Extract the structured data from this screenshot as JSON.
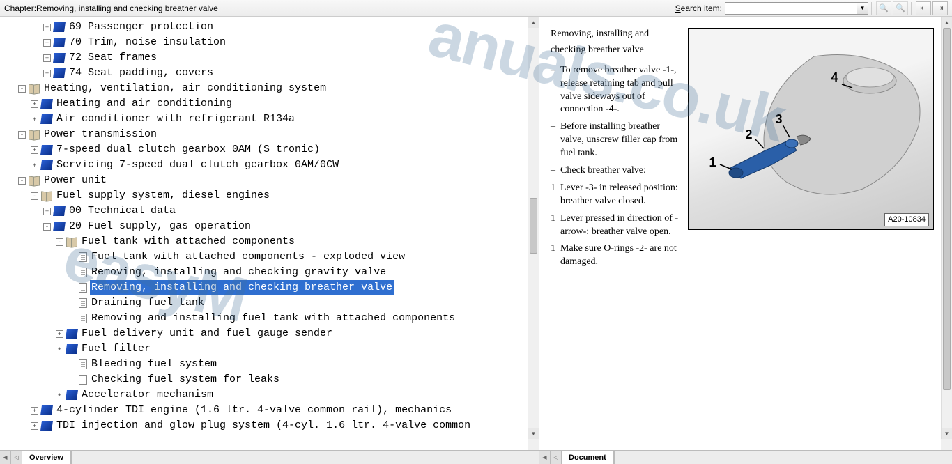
{
  "toolbar": {
    "chapter_prefix": "Chapter:",
    "chapter_title": "Removing, installing and checking breather valve",
    "search_label": "Search item:",
    "search_value": ""
  },
  "tree": [
    {
      "depth": 3,
      "exp": "+",
      "icon": "blue",
      "label": "69 Passenger protection"
    },
    {
      "depth": 3,
      "exp": "+",
      "icon": "blue",
      "label": "70 Trim, noise insulation"
    },
    {
      "depth": 3,
      "exp": "+",
      "icon": "blue",
      "label": "72 Seat frames"
    },
    {
      "depth": 3,
      "exp": "+",
      "icon": "blue",
      "label": "74 Seat padding, covers"
    },
    {
      "depth": 1,
      "exp": "-",
      "icon": "book",
      "label": "Heating, ventilation, air conditioning system"
    },
    {
      "depth": 2,
      "exp": "+",
      "icon": "blue",
      "label": "Heating and air conditioning"
    },
    {
      "depth": 2,
      "exp": "+",
      "icon": "blue",
      "label": "Air conditioner with refrigerant R134a"
    },
    {
      "depth": 1,
      "exp": "-",
      "icon": "book",
      "label": "Power transmission"
    },
    {
      "depth": 2,
      "exp": "+",
      "icon": "blue",
      "label": "7-speed dual clutch gearbox 0AM (S tronic)"
    },
    {
      "depth": 2,
      "exp": "+",
      "icon": "blue",
      "label": "Servicing 7-speed dual clutch gearbox 0AM/0CW"
    },
    {
      "depth": 1,
      "exp": "-",
      "icon": "book",
      "label": "Power unit"
    },
    {
      "depth": 2,
      "exp": "-",
      "icon": "book",
      "label": "Fuel supply system, diesel engines"
    },
    {
      "depth": 3,
      "exp": "+",
      "icon": "blue",
      "label": "00 Technical data"
    },
    {
      "depth": 3,
      "exp": "-",
      "icon": "blue",
      "label": "20 Fuel supply, gas operation"
    },
    {
      "depth": 4,
      "exp": "-",
      "icon": "book",
      "label": "Fuel tank with attached components"
    },
    {
      "depth": 5,
      "exp": " ",
      "icon": "page",
      "label": "Fuel tank with attached components - exploded view"
    },
    {
      "depth": 5,
      "exp": " ",
      "icon": "page",
      "label": "Removing, installing and checking gravity valve"
    },
    {
      "depth": 5,
      "exp": " ",
      "icon": "page",
      "label": "Removing, installing and checking breather valve",
      "selected": true
    },
    {
      "depth": 5,
      "exp": " ",
      "icon": "page",
      "label": "Draining fuel tank"
    },
    {
      "depth": 5,
      "exp": " ",
      "icon": "page",
      "label": "Removing and installing fuel tank with attached components"
    },
    {
      "depth": 4,
      "exp": "+",
      "icon": "blue",
      "label": "Fuel delivery unit and fuel gauge sender"
    },
    {
      "depth": 4,
      "exp": "+",
      "icon": "blue",
      "label": "Fuel filter"
    },
    {
      "depth": 5,
      "exp": " ",
      "icon": "page",
      "label": "Bleeding fuel system"
    },
    {
      "depth": 5,
      "exp": " ",
      "icon": "page",
      "label": "Checking fuel system for leaks"
    },
    {
      "depth": 4,
      "exp": "+",
      "icon": "blue",
      "label": "Accelerator mechanism"
    },
    {
      "depth": 2,
      "exp": "+",
      "icon": "blue",
      "label": "4-cylinder TDI engine (1.6 ltr. 4-valve common rail), mechanics"
    },
    {
      "depth": 2,
      "exp": "+",
      "icon": "blue",
      "label": "TDI injection and glow plug system (4-cyl. 1.6 ltr. 4-valve common"
    }
  ],
  "tabs": {
    "left": "Overview",
    "right": "Document"
  },
  "content": {
    "title1": "Removing, installing and",
    "title2": "checking breather valve",
    "steps": [
      {
        "m": "–",
        "t": "To remove breather valve -1-, release retaining tab and pull valve sideways out of connection -4-."
      },
      {
        "m": "–",
        "t": "Before installing breather valve, unscrew filler cap from fuel tank."
      },
      {
        "m": "–",
        "t": "Check breather valve:"
      },
      {
        "m": "1",
        "t": "Lever -3- in released position: breather valve closed."
      },
      {
        "m": "1",
        "t": "Lever pressed in direction of -arrow-: breather valve open."
      },
      {
        "m": "1",
        "t": "Make sure O-rings -2- are not damaged."
      }
    ],
    "figure": {
      "callouts": [
        "1",
        "2",
        "3",
        "4"
      ],
      "ref": "A20-10834"
    }
  },
  "watermark1": "easyM",
  "watermark2": "anuals.co.uk"
}
